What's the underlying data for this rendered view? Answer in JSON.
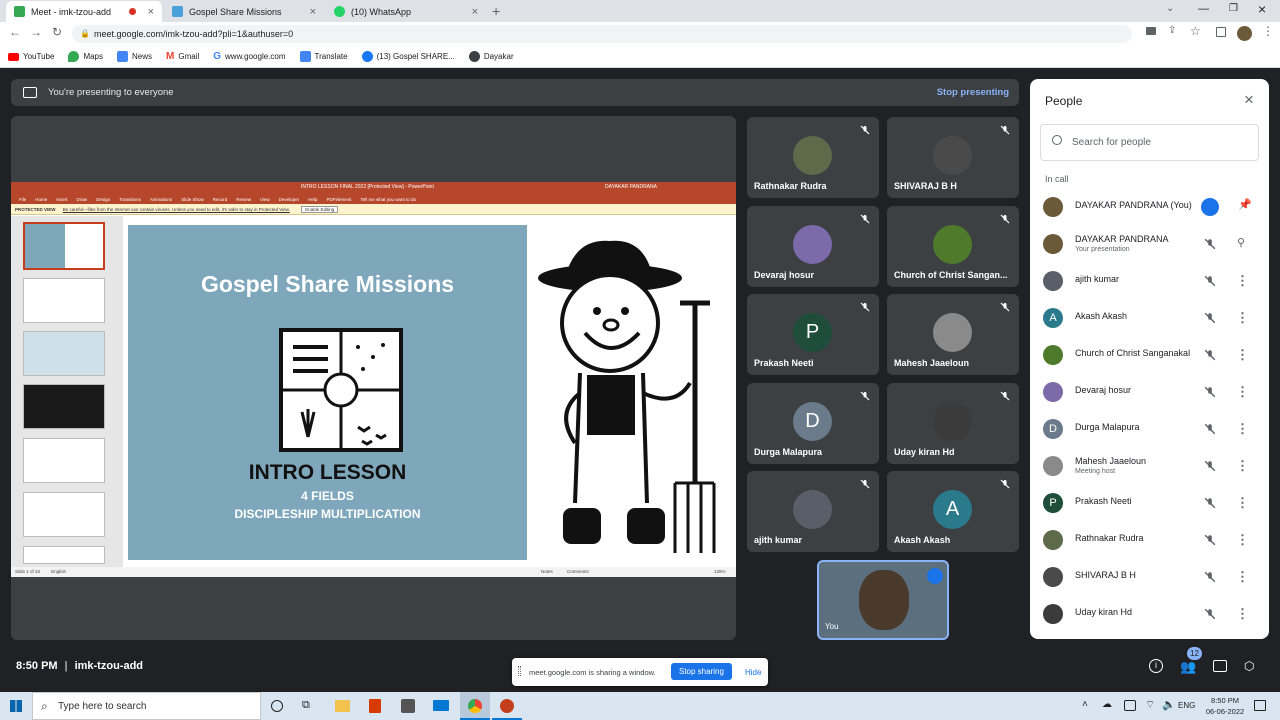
{
  "browser": {
    "tabs": [
      {
        "title": "Meet - imk-tzou-add",
        "active": true
      },
      {
        "title": "Gospel Share Missions",
        "active": false
      },
      {
        "title": "(10) WhatsApp",
        "active": false
      }
    ],
    "url": "meet.google.com/imk-tzou-add?pli=1&authuser=0",
    "bookmarks": [
      "YouTube",
      "Maps",
      "News",
      "Gmail",
      "www.google.com",
      "Translate",
      "(13) Gospel SHARE...",
      "Dayakar"
    ]
  },
  "meet": {
    "presenting_text": "You're presenting to everyone",
    "stop_presenting": "Stop presenting",
    "time": "8:50 PM",
    "separator": "|",
    "meeting_code": "imk-tzou-add",
    "sharing_notice": "meet.google.com is sharing a window.",
    "stop_sharing": "Stop sharing",
    "hide": "Hide",
    "participant_count": "12",
    "self_label": "You"
  },
  "slide": {
    "title": "Gospel Share Missions",
    "lesson": "INTRO LESSON",
    "line1": "4 FIELDS",
    "line2": "DISCIPLESHIP MULTIPLICATION",
    "window_title": "INTRO LESSON FINAL 2022 [Protected View] - PowerPoint",
    "user": "DAYAKAR PANDRANA",
    "protected_view_label": "PROTECTED VIEW",
    "protected_view_msg": "Be careful—files from the Internet can contain viruses. Unless you need to edit, it's safer to stay in Protected View.",
    "enable_editing": "Enable Editing",
    "ribbon_tabs": [
      "File",
      "Home",
      "Insert",
      "Draw",
      "Design",
      "Transitions",
      "Animations",
      "Slide Show",
      "Record",
      "Review",
      "View",
      "Developer",
      "Help",
      "PDFelement"
    ],
    "tell_me": "Tell me what you want to do",
    "status_left": "Slide 1 of 33",
    "status_lang": "English",
    "notes": "Notes",
    "comments": "Comments",
    "zoom": "125%"
  },
  "tiles": [
    {
      "name": "Rathnakar Rudra",
      "avatar": "photo",
      "color": "#5d6b4a"
    },
    {
      "name": "SHIVARAJ B H",
      "avatar": "photo",
      "color": "#4a4a4a"
    },
    {
      "name": "Devaraj hosur",
      "avatar": "photo",
      "color": "#7d6aa8"
    },
    {
      "name": "Church of Christ Sangan...",
      "avatar": "photo",
      "color": "#4f7a2c"
    },
    {
      "name": "Prakash Neeti",
      "avatar": "P",
      "color": "#1e4d3a"
    },
    {
      "name": "Mahesh Jaaeloun",
      "avatar": "photo",
      "color": "#8a8a8a"
    },
    {
      "name": "Durga Malapura",
      "avatar": "D",
      "color": "#6b7b8c"
    },
    {
      "name": "Uday kiran Hd",
      "avatar": "photo",
      "color": "#3b3b3b"
    },
    {
      "name": "ajith kumar",
      "avatar": "photo",
      "color": "#5a5e68"
    },
    {
      "name": "Akash Akash",
      "avatar": "A",
      "color": "#2b7a8c"
    }
  ],
  "people_panel": {
    "title": "People",
    "search_placeholder": "Search for people",
    "section": "In call",
    "rows": [
      {
        "name": "DAYAKAR PANDRANA (You)",
        "sub": "",
        "avatar": "photo",
        "color": "#6b5a3a"
      },
      {
        "name": "DAYAKAR PANDRANA",
        "sub": "Your presentation",
        "avatar": "photo",
        "color": "#6b5a3a"
      },
      {
        "name": "ajith kumar",
        "sub": "",
        "avatar": "photo",
        "color": "#5a5e68"
      },
      {
        "name": "Akash Akash",
        "sub": "",
        "avatar": "A",
        "color": "#2b7a8c"
      },
      {
        "name": "Church of Christ Sanganakal",
        "sub": "",
        "avatar": "photo",
        "color": "#4f7a2c"
      },
      {
        "name": "Devaraj hosur",
        "sub": "",
        "avatar": "photo",
        "color": "#7d6aa8"
      },
      {
        "name": "Durga Malapura",
        "sub": "",
        "avatar": "D",
        "color": "#6b7b8c"
      },
      {
        "name": "Mahesh Jaaeloun",
        "sub": "Meeting host",
        "avatar": "photo",
        "color": "#8a8a8a"
      },
      {
        "name": "Prakash Neeti",
        "sub": "",
        "avatar": "P",
        "color": "#1e4d3a"
      },
      {
        "name": "Rathnakar Rudra",
        "sub": "",
        "avatar": "photo",
        "color": "#5d6b4a"
      },
      {
        "name": "SHIVARAJ B H",
        "sub": "",
        "avatar": "photo",
        "color": "#4a4a4a"
      },
      {
        "name": "Uday kiran Hd",
        "sub": "",
        "avatar": "photo",
        "color": "#3b3b3b"
      }
    ]
  },
  "taskbar": {
    "search_placeholder": "Type here to search",
    "lang": "ENG",
    "time": "8:50 PM",
    "date": "06-06-2022"
  }
}
